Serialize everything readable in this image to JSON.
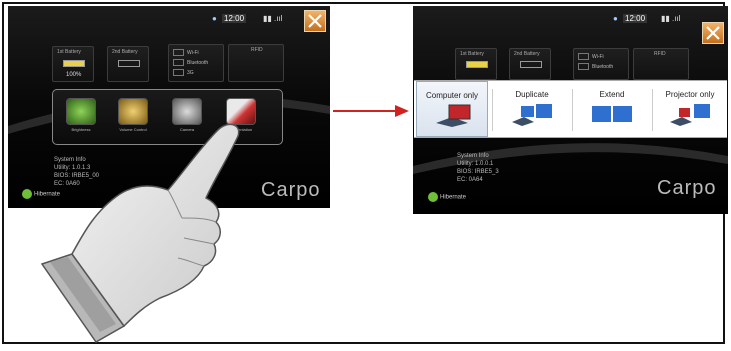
{
  "left_screen": {
    "battery1": {
      "label": "1st Battery",
      "percent": "100%"
    },
    "battery2": {
      "label": "2nd Battery"
    },
    "wireless": {
      "items": [
        "Wi-Fi",
        "Bluetooth",
        "3G"
      ]
    },
    "rfid": {
      "label": "RFID"
    },
    "apps": [
      {
        "label": "Brightness"
      },
      {
        "label": "Volume Control"
      },
      {
        "label": "Camera"
      },
      {
        "label": "Presentation"
      }
    ],
    "sysinfo": [
      "System Info",
      "Utility: 1.0.1.3",
      "BIOS: IRBE5_00",
      "EC: 0A60"
    ],
    "brand": "Carpo",
    "hibernate": "Hibernate",
    "tray_clock": "12:00"
  },
  "right_screen": {
    "battery1": {
      "label": "1st Battery"
    },
    "battery2": {
      "label": "2nd Battery"
    },
    "wireless": {
      "items": [
        "Wi-Fi",
        "Bluetooth"
      ]
    },
    "rfid": {
      "label": "RFID"
    },
    "display_options": [
      {
        "label": "Computer only",
        "selected": true
      },
      {
        "label": "Duplicate",
        "selected": false
      },
      {
        "label": "Extend",
        "selected": false
      },
      {
        "label": "Projector only",
        "selected": false
      }
    ],
    "sysinfo": [
      "System Info",
      "Utility: 1.0.0.1",
      "BIOS: IRBE5_3",
      "EC: 0A64"
    ],
    "brand": "Carpo",
    "hibernate": "Hibernate",
    "tray_clock": "12:00"
  },
  "colors": {
    "arrow": "#d0231f",
    "hibernate": "#6fbf3a",
    "battery_fill": "#e8d24a",
    "close_button": "#e08a2c"
  }
}
